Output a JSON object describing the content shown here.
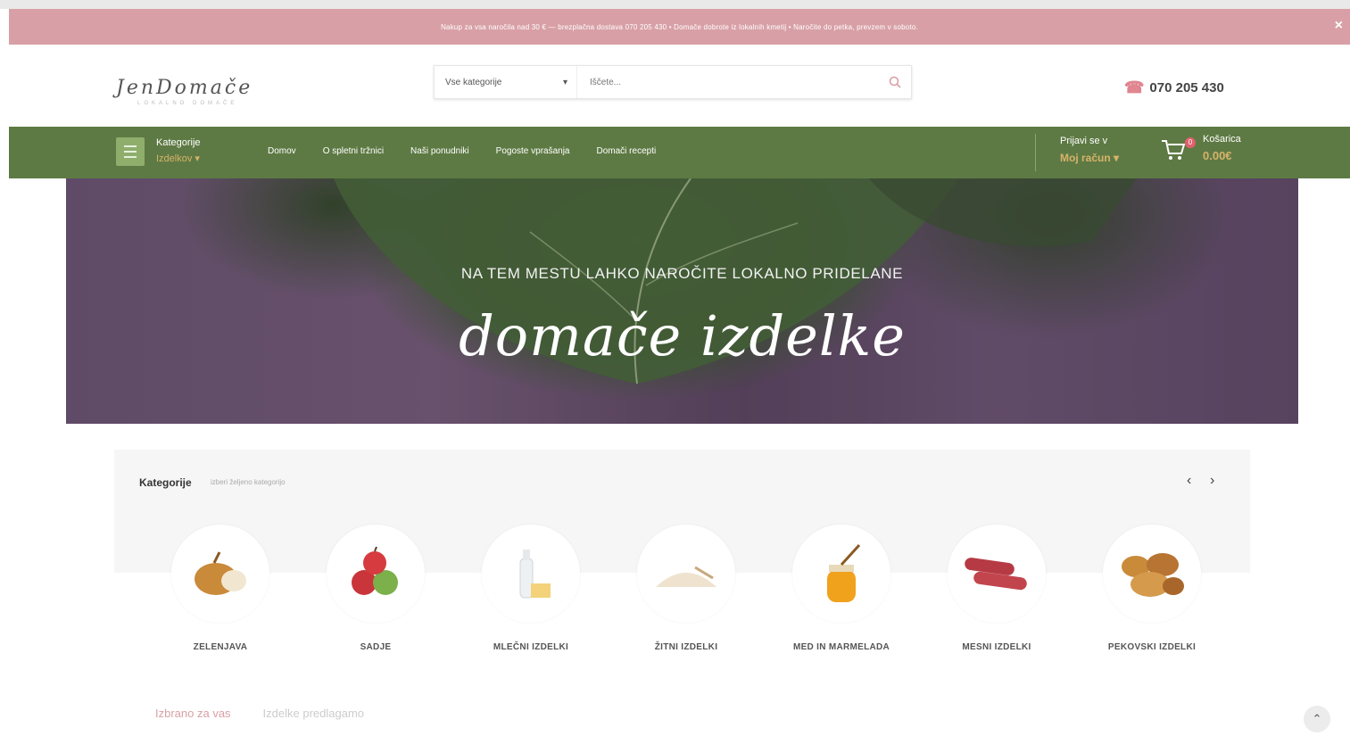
{
  "promo": {
    "text": "Nakup za vsa naročila nad 30 € — brezplačna dostava 070 205 430 • Domače dobrote iz lokalnih kmetij • Naročite do petka, prevzem v soboto.",
    "close": "×"
  },
  "header": {
    "logo": "JenDomače",
    "logo_sub": "LOKALNO DOMAČE",
    "search_category": "Vse kategorije",
    "search_placeholder": "Iščete...",
    "phone": "070 205 430"
  },
  "nav": {
    "categories_label": "Kategorije",
    "categories_sub": "Izdelkov",
    "menu": [
      "Domov",
      "O spletni tržnici",
      "Naši ponudniki",
      "Pogoste vprašanja",
      "Domači recepti"
    ],
    "login_label": "Prijavi se v",
    "login_sub": "Moj račun",
    "cart_label": "Košarica",
    "cart_total": "0.00€",
    "cart_count": "0"
  },
  "hero": {
    "line": "NA TEM MESTU LAHKO NAROČITE LOKALNO PRIDELANE",
    "title": "domače izdelke"
  },
  "categories": {
    "title": "Kategorije",
    "subtitle": "izberi željeno kategorijo",
    "items": [
      {
        "name": "ZELENJAVA",
        "icon": "onion-icon"
      },
      {
        "name": "SADJE",
        "icon": "apples-icon"
      },
      {
        "name": "MLEČNI IZDELKI",
        "icon": "milk-icon"
      },
      {
        "name": "ŽITNI IZDELKI",
        "icon": "flour-icon"
      },
      {
        "name": "MED IN MARMELADA",
        "icon": "honey-icon"
      },
      {
        "name": "MESNI IZDELKI",
        "icon": "sausage-icon"
      },
      {
        "name": "PEKOVSKI IZDELKI",
        "icon": "bread-icon"
      }
    ]
  },
  "tabs": {
    "active": "Izbrano za vas",
    "other": "Izdelke predlagamo"
  },
  "colors": {
    "promo": "#d8a0a6",
    "nav": "#5e7a44",
    "accent_gold": "#d6b36a"
  }
}
